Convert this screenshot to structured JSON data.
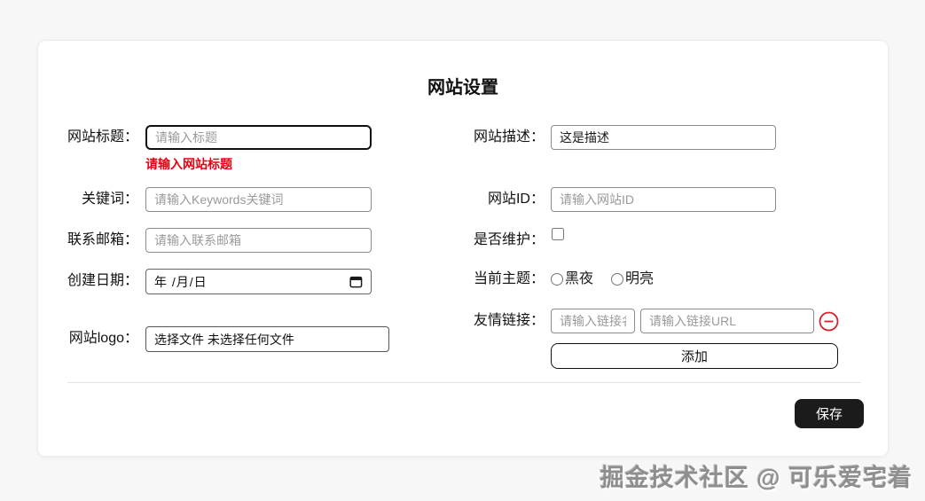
{
  "page": {
    "watermark": "掘金技术社区 @ 可乐爱宅着"
  },
  "form": {
    "title": "网站设置",
    "left": {
      "site_title": {
        "label": "网站标题：",
        "placeholder": "请输入标题",
        "value": "",
        "error": "请输入网站标题"
      },
      "keywords": {
        "label": "关键词：",
        "placeholder": "请输入Keywords关键词",
        "value": ""
      },
      "email": {
        "label": "联系邮箱：",
        "placeholder": "请输入联系邮箱",
        "value": ""
      },
      "create_date": {
        "label": "创建日期：",
        "value": "年 /月/日"
      },
      "logo": {
        "label": "网站logo：",
        "value": "选择文件 未选择任何文件"
      }
    },
    "right": {
      "description": {
        "label": "网站描述：",
        "value": "这是描述"
      },
      "site_id": {
        "label": "网站ID：",
        "placeholder": "请输入网站ID",
        "value": ""
      },
      "maintenance": {
        "label": "是否维护：",
        "checked": false
      },
      "theme": {
        "label": "当前主题：",
        "options": [
          "黑夜",
          "明亮"
        ],
        "selected": ""
      },
      "links": {
        "label": "友情链接：",
        "name_placeholder": "请输入链接名",
        "url_placeholder": "请输入链接URL",
        "add_label": "添加"
      }
    },
    "save_label": "保存"
  },
  "colors": {
    "error_text": "#e60012",
    "remove_icon": "#d5232e",
    "save_button_bg": "#1b1b1b",
    "card_bg": "#ffffff",
    "page_bg": "#f7f7f7"
  }
}
